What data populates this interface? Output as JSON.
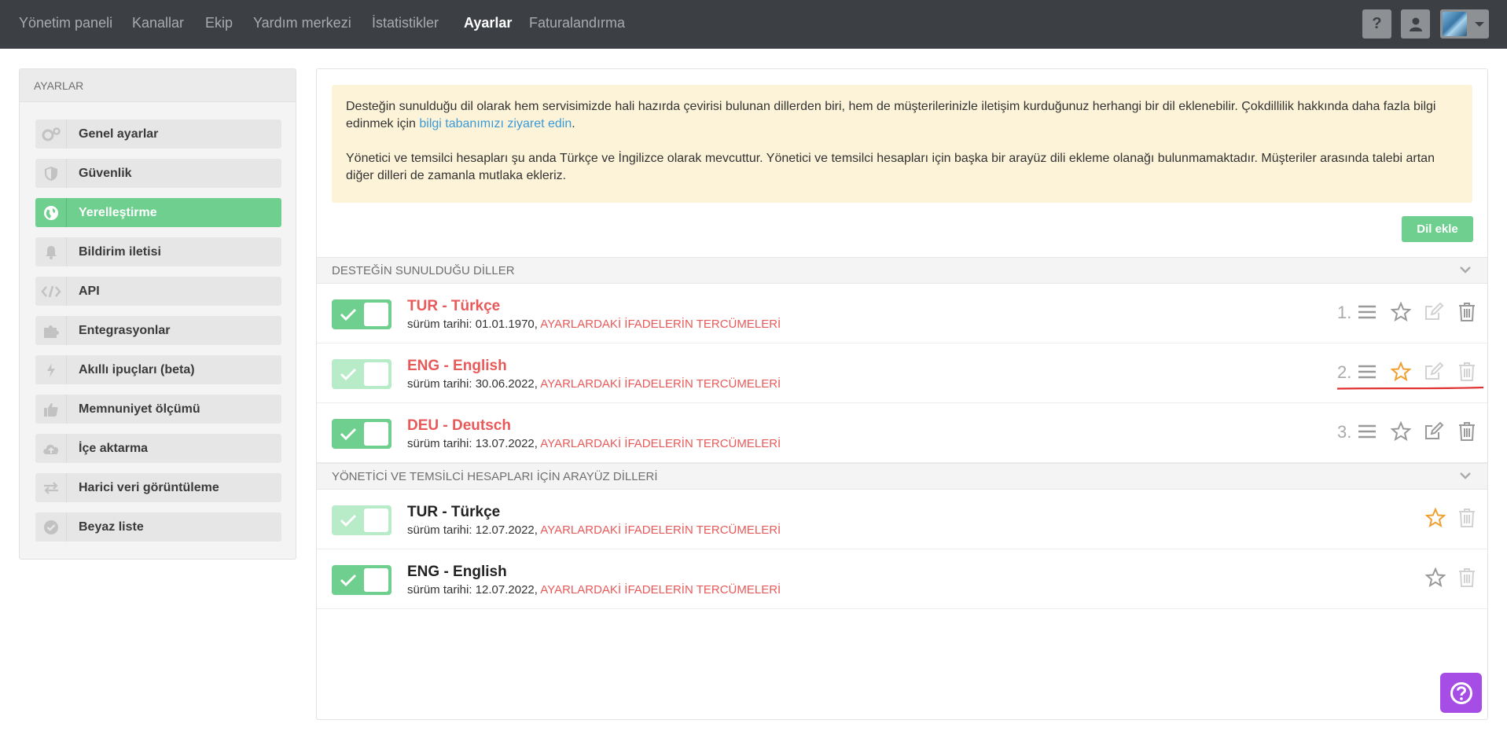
{
  "nav": {
    "items": [
      "Yönetim paneli",
      "Kanallar",
      "Ekip",
      "Yardım merkezi",
      "İstatistikler",
      "Ayarlar",
      "Faturalandırma"
    ],
    "active_index": 5,
    "help_label": "?"
  },
  "sidebar": {
    "title": "AYARLAR",
    "items": [
      {
        "label": "Genel ayarlar",
        "icon": "gears-icon"
      },
      {
        "label": "Güvenlik",
        "icon": "shield-icon"
      },
      {
        "label": "Yerelleştirme",
        "icon": "globe-icon"
      },
      {
        "label": "Bildirim iletisi",
        "icon": "bell-icon"
      },
      {
        "label": "API",
        "icon": "code-icon"
      },
      {
        "label": "Entegrasyonlar",
        "icon": "puzzle-icon"
      },
      {
        "label": "Akıllı ipuçları (beta)",
        "icon": "bolt-icon"
      },
      {
        "label": "Memnuniyet ölçümü",
        "icon": "thumbs-up-icon"
      },
      {
        "label": "İçe aktarma",
        "icon": "cloud-upload-icon"
      },
      {
        "label": "Harici veri görüntüleme",
        "icon": "exchange-icon"
      },
      {
        "label": "Beyaz liste",
        "icon": "check-badge-icon"
      }
    ],
    "active_index": 2
  },
  "notice": {
    "p1_before": "Desteğin sunulduğu dil olarak hem servisimizde hali hazırda çevirisi bulunan dillerden biri, hem de müşterilerinizle iletişim kurduğunuz herhangi bir dil eklenebilir. Çokdillilik hakkında daha fazla bilgi edinmek için ",
    "p1_link": "bilgi tabanımızı ziyaret edin",
    "p1_after": ".",
    "p2": "Yönetici ve temsilci hesapları şu anda Türkçe ve İngilizce olarak mevcuttur. Yönetici ve temsilci hesapları için başka bir arayüz dili ekleme olanağı bulunmamaktadır. Müşteriler arasında talebi artan diğer dilleri de zamanla mutlaka ekleriz."
  },
  "add_language_label": "Dil ekle",
  "support_section": {
    "title": "DESTEĞİN SUNULDUĞU DİLLER",
    "rows": [
      {
        "order": "1.",
        "name": "TUR - Türkçe",
        "date_prefix": "sürüm tarihi: ",
        "date": "01.01.1970",
        "sep": ", ",
        "link": "AYARLARDAKİ İFADELERİN TERCÜMELERİ"
      },
      {
        "order": "2.",
        "name": "ENG - English",
        "date_prefix": "sürüm tarihi: ",
        "date": "30.06.2022",
        "sep": ", ",
        "link": "AYARLARDAKİ İFADELERİN TERCÜMELERİ"
      },
      {
        "order": "3.",
        "name": "DEU - Deutsch",
        "date_prefix": "sürüm tarihi: ",
        "date": "13.07.2022",
        "sep": ", ",
        "link": "AYARLARDAKİ İFADELERİN TERCÜMELERİ"
      }
    ]
  },
  "ui_section": {
    "title": "YÖNETİCİ VE TEMSİLCİ HESAPLARI İÇİN ARAYÜZ DİLLERİ",
    "rows": [
      {
        "name": "TUR - Türkçe",
        "date_prefix": "sürüm tarihi: ",
        "date": "12.07.2022",
        "sep": ", ",
        "link": "AYARLARDAKİ İFADELERİN TERCÜMELERİ"
      },
      {
        "name": "ENG - English",
        "date_prefix": "sürüm tarihi: ",
        "date": "12.07.2022",
        "sep": ", ",
        "link": "AYARLARDAKİ İFADELERİN TERCÜMELERİ"
      }
    ]
  },
  "colors": {
    "green": "#6fcf8f",
    "green_light": "#b8ebc8",
    "red": "#e85a5a",
    "star_active": "#f0a030",
    "annotation_line": "#e03030",
    "help_fab": "#a64de6"
  }
}
